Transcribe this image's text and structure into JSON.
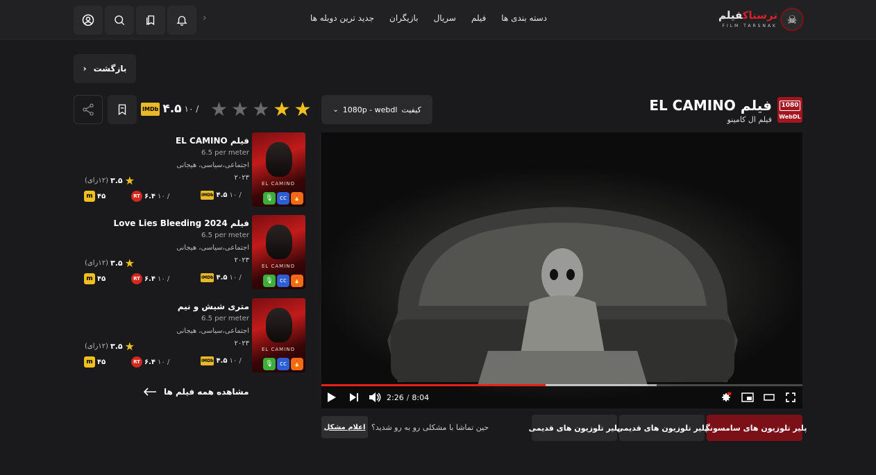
{
  "header": {
    "logo_text_a": "فیلم",
    "logo_text_b": "ترسناک",
    "logo_sub": "FILM TARSNAK",
    "nav": [
      "دسته بندی ها",
      "فیلم",
      "سریال",
      "بازیگران",
      "جدید ترین دوبله ها"
    ]
  },
  "back_label": "بازگشت",
  "movie": {
    "badge_top": "1080",
    "badge_bottom": "WebDL",
    "title": "فیلم EL CAMINO",
    "subtitle": "فیلم ال کامینو",
    "quality_label": "کیفیت",
    "quality_value": "1080p - webdl",
    "rating": "۴.۵",
    "rating_of": "۱۰ /",
    "imdb": "IMDb",
    "stars_filled": 2,
    "stars_total": 5
  },
  "player": {
    "time_current": "2:26",
    "time_total": "8:04",
    "progress_fraction": 0.466,
    "buffered_fraction": 0.697
  },
  "player_buttons": [
    "پلیر تلوزیون های سامسونگ",
    "پلیر تلوزیون های قدیمی",
    "پلیر تلوزیون های قدیمی"
  ],
  "problem": {
    "text": "حین تماشا با مشکلی رو به رو شدید؟",
    "button": "اعلام مشکل"
  },
  "related": [
    {
      "title": "فیلم EL CAMINO",
      "price": "6.5 per meter",
      "genre": "اجتماعی،سیاسی، هیجانی",
      "year": "۲۰۲۳",
      "rate": "۳.۵",
      "votes": "(۱۲رای)",
      "imdb": "۴.۵",
      "imdb_of": "۱۰ /",
      "rt": "۶.۴",
      "rt_of": "۱۰ /",
      "mc": "۴۵",
      "poster_title": "EL CAMINO"
    },
    {
      "title": "فیلم Love Lies Bleeding 2024",
      "price": "6.5 per meter",
      "genre": "اجتماعی،سیاسی، هیجانی",
      "year": "۲۰۲۳",
      "rate": "۳.۵",
      "votes": "(۱۲رای)",
      "imdb": "۴.۵",
      "imdb_of": "۱۰ /",
      "rt": "۶.۴",
      "rt_of": "۱۰ /",
      "mc": "۴۵",
      "poster_title": "EL CAMINO"
    },
    {
      "title": "متری شیش و نیم",
      "price": "6.5 per meter",
      "genre": "اجتماعی،سیاسی، هیجانی",
      "year": "۲۰۲۳",
      "rate": "۳.۵",
      "votes": "(۱۲رای)",
      "imdb": "۴.۵",
      "imdb_of": "۱۰ /",
      "rt": "۶.۴",
      "rt_of": "۱۰ /",
      "mc": "۴۵",
      "poster_title": "EL CAMINO"
    }
  ],
  "view_all": "مشاهده همه فیلم ها",
  "labels": {
    "imdb_small": "IMDb",
    "rt_small": "RT"
  },
  "colors": {
    "accent": "#a3151f",
    "star": "#f2c01e",
    "imdb": "#e9b928",
    "progress": "#e62117"
  }
}
